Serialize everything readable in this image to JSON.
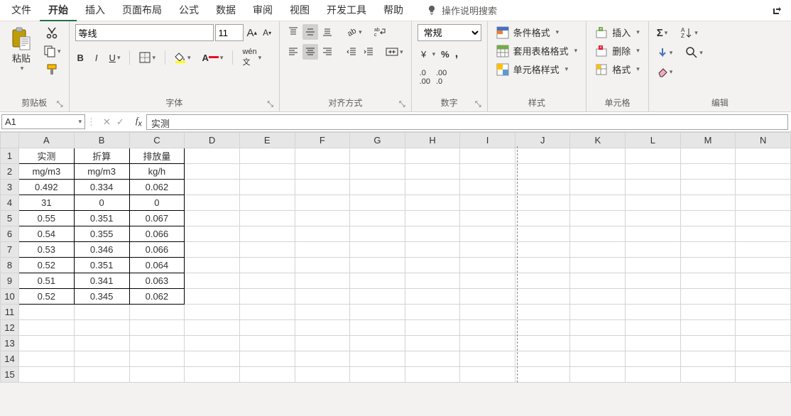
{
  "tabs": [
    "文件",
    "开始",
    "插入",
    "页面布局",
    "公式",
    "数据",
    "审阅",
    "视图",
    "开发工具",
    "帮助"
  ],
  "active_tab": 1,
  "tell_me": "操作说明搜索",
  "ribbon": {
    "clipboard": {
      "label": "剪贴板",
      "paste": "粘贴"
    },
    "font": {
      "label": "字体",
      "name": "等线",
      "size": "11"
    },
    "align": {
      "label": "对齐方式"
    },
    "number": {
      "label": "数字",
      "format": "常规"
    },
    "styles": {
      "label": "样式",
      "cond": "条件格式",
      "table": "套用表格格式",
      "cell": "单元格样式"
    },
    "cells": {
      "label": "单元格",
      "insert": "插入",
      "delete": "删除",
      "format": "格式"
    },
    "editing": {
      "label": "编辑"
    }
  },
  "namebox": "A1",
  "formula": "实测",
  "columns": [
    "A",
    "B",
    "C",
    "D",
    "E",
    "F",
    "G",
    "H",
    "I",
    "J",
    "K",
    "L",
    "M",
    "N"
  ],
  "row_count": 15,
  "data": [
    [
      "实测",
      "折算",
      "排放量"
    ],
    [
      "mg/m3",
      "mg/m3",
      "kg/h"
    ],
    [
      "0.492",
      "0.334",
      "0.062"
    ],
    [
      "31",
      "0",
      "0"
    ],
    [
      "0.55",
      "0.351",
      "0.067"
    ],
    [
      "0.54",
      "0.355",
      "0.066"
    ],
    [
      "0.53",
      "0.346",
      "0.066"
    ],
    [
      "0.52",
      "0.351",
      "0.064"
    ],
    [
      "0.51",
      "0.341",
      "0.063"
    ],
    [
      "0.52",
      "0.345",
      "0.062"
    ]
  ],
  "bordered_rows": 10,
  "bordered_cols": 3,
  "pagebreak_after_col": 9
}
